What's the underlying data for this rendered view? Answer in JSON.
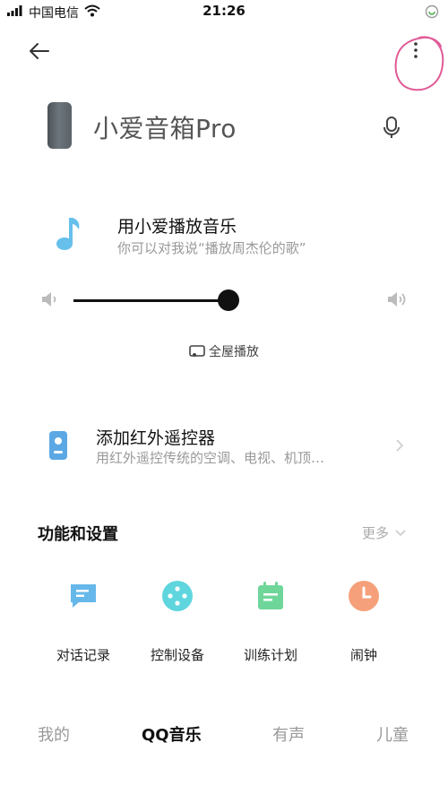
{
  "status_bar": {
    "carrier": "中国电信",
    "time": "21:26"
  },
  "device": {
    "name": "小爱音箱Pro"
  },
  "music": {
    "title": "用小爱播放音乐",
    "hint": "你可以对我说“播放周杰伦的歌”"
  },
  "volume": {
    "level_percent": 52
  },
  "whole_house": {
    "label": "全屋播放"
  },
  "ir_remote": {
    "title": "添加红外遥控器",
    "subtitle": "用红外遥控传统的空调、电视、机顶…"
  },
  "features_section": {
    "title": "功能和设置",
    "more_label": "更多"
  },
  "features": [
    {
      "label": "对话记录",
      "icon": "chat-log-icon",
      "color": "#66b8ea"
    },
    {
      "label": "控制设备",
      "icon": "control-device-icon",
      "color": "#5fd6de"
    },
    {
      "label": "训练计划",
      "icon": "training-plan-icon",
      "color": "#6fd69a"
    },
    {
      "label": "闹钟",
      "icon": "alarm-clock-icon",
      "color": "#f5a07a"
    }
  ],
  "bottom_tabs": [
    {
      "label": "我的",
      "active": false
    },
    {
      "label": "QQ音乐",
      "active": true
    },
    {
      "label": "有声",
      "active": false
    },
    {
      "label": "儿童",
      "active": false
    }
  ],
  "colors": {
    "accent_blue": "#5ca8e4",
    "annotation_pink": "#e05a95"
  }
}
